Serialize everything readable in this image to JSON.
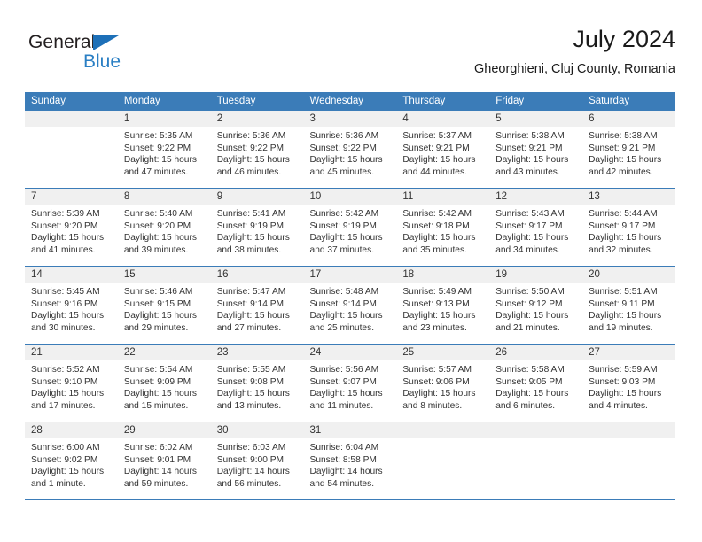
{
  "brand": {
    "name_part1": "General",
    "name_part2": "Blue",
    "flag_icon": "triangle-flag-icon",
    "colors": {
      "general_text": "#231f20",
      "blue_text": "#2a7fc4",
      "flag": "#1d70b8"
    }
  },
  "header": {
    "title": "July 2024",
    "subtitle": "Gheorghieni, Cluj County, Romania"
  },
  "theme": {
    "header_bar": "#3b7cb8",
    "day_band": "#f0f0f0",
    "text": "#333333"
  },
  "weekdays": [
    "Sunday",
    "Monday",
    "Tuesday",
    "Wednesday",
    "Thursday",
    "Friday",
    "Saturday"
  ],
  "weeks": [
    [
      {
        "day": "",
        "sunrise": "",
        "sunset": "",
        "daylight_line1": "",
        "daylight_line2": ""
      },
      {
        "day": "1",
        "sunrise": "Sunrise: 5:35 AM",
        "sunset": "Sunset: 9:22 PM",
        "daylight_line1": "Daylight: 15 hours",
        "daylight_line2": "and 47 minutes."
      },
      {
        "day": "2",
        "sunrise": "Sunrise: 5:36 AM",
        "sunset": "Sunset: 9:22 PM",
        "daylight_line1": "Daylight: 15 hours",
        "daylight_line2": "and 46 minutes."
      },
      {
        "day": "3",
        "sunrise": "Sunrise: 5:36 AM",
        "sunset": "Sunset: 9:22 PM",
        "daylight_line1": "Daylight: 15 hours",
        "daylight_line2": "and 45 minutes."
      },
      {
        "day": "4",
        "sunrise": "Sunrise: 5:37 AM",
        "sunset": "Sunset: 9:21 PM",
        "daylight_line1": "Daylight: 15 hours",
        "daylight_line2": "and 44 minutes."
      },
      {
        "day": "5",
        "sunrise": "Sunrise: 5:38 AM",
        "sunset": "Sunset: 9:21 PM",
        "daylight_line1": "Daylight: 15 hours",
        "daylight_line2": "and 43 minutes."
      },
      {
        "day": "6",
        "sunrise": "Sunrise: 5:38 AM",
        "sunset": "Sunset: 9:21 PM",
        "daylight_line1": "Daylight: 15 hours",
        "daylight_line2": "and 42 minutes."
      }
    ],
    [
      {
        "day": "7",
        "sunrise": "Sunrise: 5:39 AM",
        "sunset": "Sunset: 9:20 PM",
        "daylight_line1": "Daylight: 15 hours",
        "daylight_line2": "and 41 minutes."
      },
      {
        "day": "8",
        "sunrise": "Sunrise: 5:40 AM",
        "sunset": "Sunset: 9:20 PM",
        "daylight_line1": "Daylight: 15 hours",
        "daylight_line2": "and 39 minutes."
      },
      {
        "day": "9",
        "sunrise": "Sunrise: 5:41 AM",
        "sunset": "Sunset: 9:19 PM",
        "daylight_line1": "Daylight: 15 hours",
        "daylight_line2": "and 38 minutes."
      },
      {
        "day": "10",
        "sunrise": "Sunrise: 5:42 AM",
        "sunset": "Sunset: 9:19 PM",
        "daylight_line1": "Daylight: 15 hours",
        "daylight_line2": "and 37 minutes."
      },
      {
        "day": "11",
        "sunrise": "Sunrise: 5:42 AM",
        "sunset": "Sunset: 9:18 PM",
        "daylight_line1": "Daylight: 15 hours",
        "daylight_line2": "and 35 minutes."
      },
      {
        "day": "12",
        "sunrise": "Sunrise: 5:43 AM",
        "sunset": "Sunset: 9:17 PM",
        "daylight_line1": "Daylight: 15 hours",
        "daylight_line2": "and 34 minutes."
      },
      {
        "day": "13",
        "sunrise": "Sunrise: 5:44 AM",
        "sunset": "Sunset: 9:17 PM",
        "daylight_line1": "Daylight: 15 hours",
        "daylight_line2": "and 32 minutes."
      }
    ],
    [
      {
        "day": "14",
        "sunrise": "Sunrise: 5:45 AM",
        "sunset": "Sunset: 9:16 PM",
        "daylight_line1": "Daylight: 15 hours",
        "daylight_line2": "and 30 minutes."
      },
      {
        "day": "15",
        "sunrise": "Sunrise: 5:46 AM",
        "sunset": "Sunset: 9:15 PM",
        "daylight_line1": "Daylight: 15 hours",
        "daylight_line2": "and 29 minutes."
      },
      {
        "day": "16",
        "sunrise": "Sunrise: 5:47 AM",
        "sunset": "Sunset: 9:14 PM",
        "daylight_line1": "Daylight: 15 hours",
        "daylight_line2": "and 27 minutes."
      },
      {
        "day": "17",
        "sunrise": "Sunrise: 5:48 AM",
        "sunset": "Sunset: 9:14 PM",
        "daylight_line1": "Daylight: 15 hours",
        "daylight_line2": "and 25 minutes."
      },
      {
        "day": "18",
        "sunrise": "Sunrise: 5:49 AM",
        "sunset": "Sunset: 9:13 PM",
        "daylight_line1": "Daylight: 15 hours",
        "daylight_line2": "and 23 minutes."
      },
      {
        "day": "19",
        "sunrise": "Sunrise: 5:50 AM",
        "sunset": "Sunset: 9:12 PM",
        "daylight_line1": "Daylight: 15 hours",
        "daylight_line2": "and 21 minutes."
      },
      {
        "day": "20",
        "sunrise": "Sunrise: 5:51 AM",
        "sunset": "Sunset: 9:11 PM",
        "daylight_line1": "Daylight: 15 hours",
        "daylight_line2": "and 19 minutes."
      }
    ],
    [
      {
        "day": "21",
        "sunrise": "Sunrise: 5:52 AM",
        "sunset": "Sunset: 9:10 PM",
        "daylight_line1": "Daylight: 15 hours",
        "daylight_line2": "and 17 minutes."
      },
      {
        "day": "22",
        "sunrise": "Sunrise: 5:54 AM",
        "sunset": "Sunset: 9:09 PM",
        "daylight_line1": "Daylight: 15 hours",
        "daylight_line2": "and 15 minutes."
      },
      {
        "day": "23",
        "sunrise": "Sunrise: 5:55 AM",
        "sunset": "Sunset: 9:08 PM",
        "daylight_line1": "Daylight: 15 hours",
        "daylight_line2": "and 13 minutes."
      },
      {
        "day": "24",
        "sunrise": "Sunrise: 5:56 AM",
        "sunset": "Sunset: 9:07 PM",
        "daylight_line1": "Daylight: 15 hours",
        "daylight_line2": "and 11 minutes."
      },
      {
        "day": "25",
        "sunrise": "Sunrise: 5:57 AM",
        "sunset": "Sunset: 9:06 PM",
        "daylight_line1": "Daylight: 15 hours",
        "daylight_line2": "and 8 minutes."
      },
      {
        "day": "26",
        "sunrise": "Sunrise: 5:58 AM",
        "sunset": "Sunset: 9:05 PM",
        "daylight_line1": "Daylight: 15 hours",
        "daylight_line2": "and 6 minutes."
      },
      {
        "day": "27",
        "sunrise": "Sunrise: 5:59 AM",
        "sunset": "Sunset: 9:03 PM",
        "daylight_line1": "Daylight: 15 hours",
        "daylight_line2": "and 4 minutes."
      }
    ],
    [
      {
        "day": "28",
        "sunrise": "Sunrise: 6:00 AM",
        "sunset": "Sunset: 9:02 PM",
        "daylight_line1": "Daylight: 15 hours",
        "daylight_line2": "and 1 minute."
      },
      {
        "day": "29",
        "sunrise": "Sunrise: 6:02 AM",
        "sunset": "Sunset: 9:01 PM",
        "daylight_line1": "Daylight: 14 hours",
        "daylight_line2": "and 59 minutes."
      },
      {
        "day": "30",
        "sunrise": "Sunrise: 6:03 AM",
        "sunset": "Sunset: 9:00 PM",
        "daylight_line1": "Daylight: 14 hours",
        "daylight_line2": "and 56 minutes."
      },
      {
        "day": "31",
        "sunrise": "Sunrise: 6:04 AM",
        "sunset": "Sunset: 8:58 PM",
        "daylight_line1": "Daylight: 14 hours",
        "daylight_line2": "and 54 minutes."
      },
      {
        "day": "",
        "sunrise": "",
        "sunset": "",
        "daylight_line1": "",
        "daylight_line2": ""
      },
      {
        "day": "",
        "sunrise": "",
        "sunset": "",
        "daylight_line1": "",
        "daylight_line2": ""
      },
      {
        "day": "",
        "sunrise": "",
        "sunset": "",
        "daylight_line1": "",
        "daylight_line2": ""
      }
    ]
  ]
}
